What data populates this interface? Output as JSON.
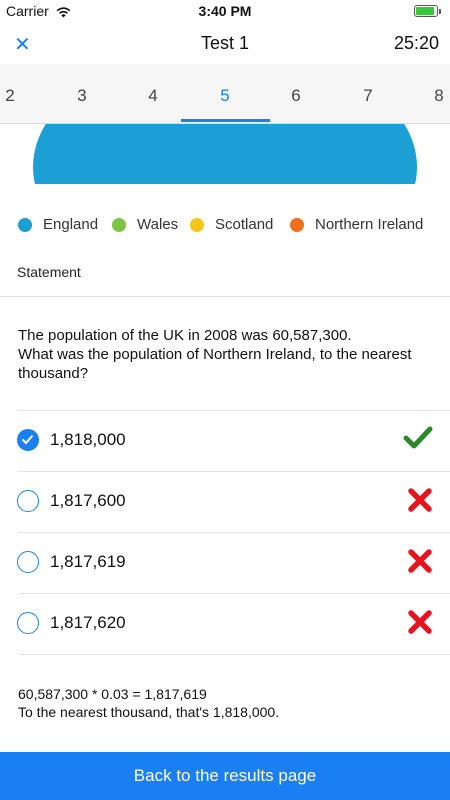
{
  "status_bar": {
    "carrier": "Carrier",
    "time": "3:40 PM",
    "icons": [
      "wifi-icon",
      "battery-icon"
    ]
  },
  "header": {
    "close_icon": "close-icon",
    "title": "Test 1",
    "timer": "25:20"
  },
  "tabs": {
    "items": [
      "2",
      "3",
      "4",
      "5",
      "6",
      "7",
      "8"
    ],
    "active": "5"
  },
  "chart": {
    "legend": [
      {
        "label": "England",
        "color": "#1b9fd4"
      },
      {
        "label": "Wales",
        "color": "#7cc443"
      },
      {
        "label": "Scotland",
        "color": "#f5c518"
      },
      {
        "label": "Northern Ireland",
        "color": "#f26f1b"
      }
    ]
  },
  "section": {
    "label": "Statement"
  },
  "question": {
    "line1": "The population of the UK in 2008 was 60,587,300.",
    "line2": "What was the population of Northern Ireland, to the nearest thousand?"
  },
  "options": [
    {
      "label": "1,818,000",
      "selected": true,
      "result": "correct"
    },
    {
      "label": "1,817,600",
      "selected": false,
      "result": "incorrect"
    },
    {
      "label": "1,817,619",
      "selected": false,
      "result": "incorrect"
    },
    {
      "label": "1,817,620",
      "selected": false,
      "result": "incorrect"
    }
  ],
  "explanation": {
    "line1": "60,587,300 * 0.03 = 1,817,619",
    "line2": "To the nearest thousand, that's 1,818,000."
  },
  "footer": {
    "back_label": "Back to the results page"
  },
  "colors": {
    "accent": "#1a7ff2",
    "correct": "#2a8a2a",
    "incorrect": "#e5141e"
  }
}
